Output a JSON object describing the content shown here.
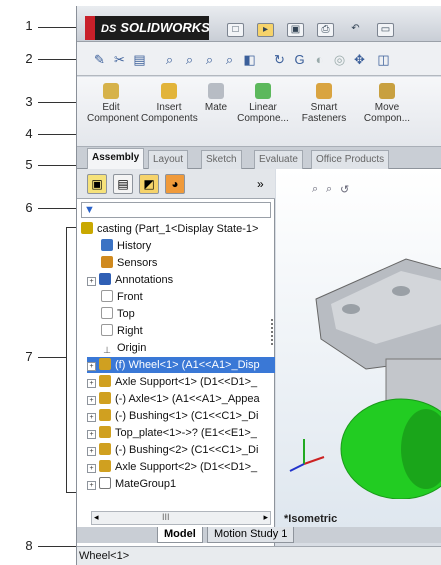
{
  "callouts": [
    "1",
    "2",
    "3",
    "4",
    "5",
    "6",
    "7",
    "8"
  ],
  "app": {
    "logo_text": "SOLIDWORKS",
    "logo_prefix": "DS"
  },
  "command_manager": {
    "items": [
      {
        "label": "Edit Component",
        "icon": "edit-component-icon"
      },
      {
        "label": "Insert Components",
        "icon": "insert-components-icon"
      },
      {
        "label": "Mate",
        "icon": "mate-icon"
      },
      {
        "label": "Linear Compone...",
        "icon": "linear-pattern-icon"
      },
      {
        "label": "Smart Fasteners",
        "icon": "smart-fasteners-icon"
      },
      {
        "label": "Move Compon...",
        "icon": "move-component-icon"
      }
    ]
  },
  "tabs": [
    "Assembly",
    "Layout",
    "Sketch",
    "Evaluate",
    "Office Products"
  ],
  "feature_manager": {
    "panel_tabs": [
      "feature-manager-tab",
      "property-manager-tab",
      "configuration-manager-tab",
      "display-manager-tab"
    ],
    "more_label": "»",
    "filter_label": "▼",
    "tree": [
      {
        "label": "casting  (Part_1<Display State-1>",
        "level": 0,
        "expand": false,
        "icon": "assembly-icon",
        "color": "#c9a800"
      },
      {
        "label": "History",
        "level": 1,
        "expand": false,
        "icon": "history-icon",
        "color": "#3b73c4"
      },
      {
        "label": "Sensors",
        "level": 1,
        "expand": false,
        "icon": "sensors-icon",
        "color": "#d08a1f"
      },
      {
        "label": "Annotations",
        "level": 1,
        "expand": true,
        "icon": "annotations-icon",
        "color": "#2f5fb5"
      },
      {
        "label": "Front",
        "level": 1,
        "expand": false,
        "icon": "plane-icon",
        "color": "#999999"
      },
      {
        "label": "Top",
        "level": 1,
        "expand": false,
        "icon": "plane-icon",
        "color": "#999999"
      },
      {
        "label": "Right",
        "level": 1,
        "expand": false,
        "icon": "plane-icon",
        "color": "#999999"
      },
      {
        "label": "Origin",
        "level": 1,
        "expand": false,
        "icon": "origin-icon",
        "color": "#555555"
      },
      {
        "label": "(f) Wheel<1> (A1<<A1>_Disp",
        "level": 1,
        "expand": true,
        "icon": "part-icon",
        "color": "#d0a020",
        "selected": true
      },
      {
        "label": "Axle Support<1> (D1<<D1>_",
        "level": 1,
        "expand": true,
        "icon": "part-icon",
        "color": "#d0a020"
      },
      {
        "label": "(-) Axle<1> (A1<<A1>_Appea",
        "level": 1,
        "expand": true,
        "icon": "part-icon",
        "color": "#d0a020"
      },
      {
        "label": "(-) Bushing<1> (C1<<C1>_Di",
        "level": 1,
        "expand": true,
        "icon": "part-icon",
        "color": "#d0a020"
      },
      {
        "label": "Top_plate<1>->? (E1<<E1>_",
        "level": 1,
        "expand": true,
        "icon": "part-icon",
        "color": "#d0a020"
      },
      {
        "label": "(-) Bushing<2> (C1<<C1>_Di",
        "level": 1,
        "expand": true,
        "icon": "part-icon",
        "color": "#d0a020"
      },
      {
        "label": "Axle Support<2> (D1<<D1>_",
        "level": 1,
        "expand": true,
        "icon": "part-icon",
        "color": "#d0a020"
      },
      {
        "label": "MateGroup1",
        "level": 1,
        "expand": true,
        "icon": "mate-group-icon",
        "color": "#777777"
      }
    ],
    "scroll_label": "III"
  },
  "bottom_tabs": [
    "Model",
    "Motion Study 1"
  ],
  "viewport": {
    "orientation": "*Isometric"
  },
  "status": {
    "text": "Wheel<1>"
  },
  "colors": {
    "selection": "#3a78d6",
    "logo_red": "#c8202a",
    "model_green": "#22cc22"
  }
}
